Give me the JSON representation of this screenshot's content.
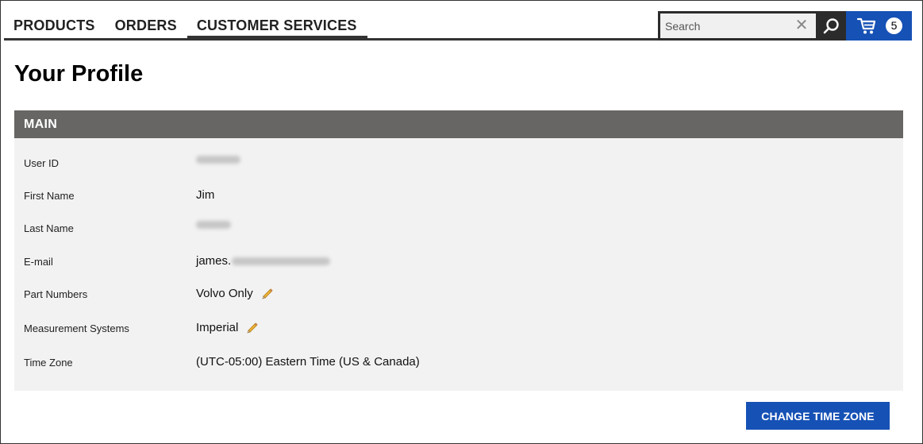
{
  "nav": {
    "items": [
      {
        "label": "PRODUCTS"
      },
      {
        "label": "ORDERS"
      },
      {
        "label": "CUSTOMER SERVICES",
        "active": true
      }
    ]
  },
  "search": {
    "placeholder": "Search",
    "value": ""
  },
  "cart": {
    "count": "5",
    "accent": "#1651b5"
  },
  "page": {
    "title": "Your Profile"
  },
  "panel": {
    "header": "MAIN",
    "header_color": "#676664",
    "fields": [
      {
        "label": "User ID",
        "value": "",
        "redacted": true
      },
      {
        "label": "First Name",
        "value": "Jim"
      },
      {
        "label": "Last Name",
        "value": "",
        "redacted": true
      },
      {
        "label": "E-mail",
        "value": "james.",
        "redacted_suffix": true
      },
      {
        "label": "Part Numbers",
        "value": "Volvo Only",
        "editable": true
      },
      {
        "label": "Measurement Systems",
        "value": "Imperial",
        "editable": true
      },
      {
        "label": "Time Zone",
        "value": "(UTC-05:00) Eastern Time (US & Canada)"
      }
    ]
  },
  "actions": {
    "change_time_zone": "CHANGE TIME ZONE"
  },
  "icons": [
    "close-icon",
    "search-icon",
    "cart-icon",
    "pencil-icon"
  ]
}
